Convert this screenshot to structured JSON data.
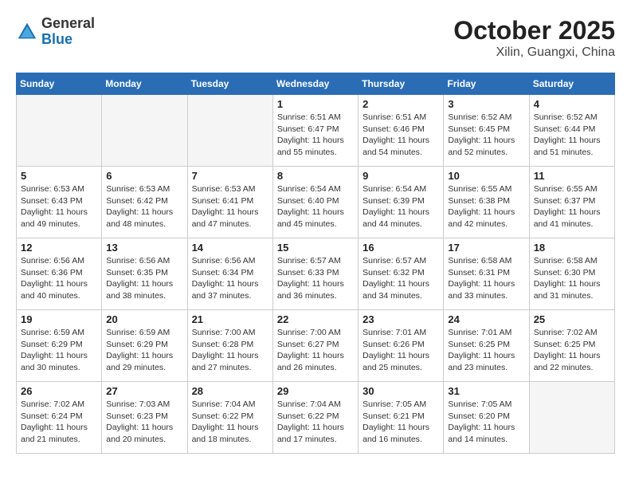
{
  "header": {
    "logo_general": "General",
    "logo_blue": "Blue",
    "title": "October 2025",
    "subtitle": "Xilin, Guangxi, China"
  },
  "days_of_week": [
    "Sunday",
    "Monday",
    "Tuesday",
    "Wednesday",
    "Thursday",
    "Friday",
    "Saturday"
  ],
  "weeks": [
    [
      {
        "day": "",
        "empty": true
      },
      {
        "day": "",
        "empty": true
      },
      {
        "day": "",
        "empty": true
      },
      {
        "day": "1",
        "sunrise": "6:51 AM",
        "sunset": "6:47 PM",
        "daylight": "11 hours and 55 minutes."
      },
      {
        "day": "2",
        "sunrise": "6:51 AM",
        "sunset": "6:46 PM",
        "daylight": "11 hours and 54 minutes."
      },
      {
        "day": "3",
        "sunrise": "6:52 AM",
        "sunset": "6:45 PM",
        "daylight": "11 hours and 52 minutes."
      },
      {
        "day": "4",
        "sunrise": "6:52 AM",
        "sunset": "6:44 PM",
        "daylight": "11 hours and 51 minutes."
      }
    ],
    [
      {
        "day": "5",
        "sunrise": "6:53 AM",
        "sunset": "6:43 PM",
        "daylight": "11 hours and 49 minutes."
      },
      {
        "day": "6",
        "sunrise": "6:53 AM",
        "sunset": "6:42 PM",
        "daylight": "11 hours and 48 minutes."
      },
      {
        "day": "7",
        "sunrise": "6:53 AM",
        "sunset": "6:41 PM",
        "daylight": "11 hours and 47 minutes."
      },
      {
        "day": "8",
        "sunrise": "6:54 AM",
        "sunset": "6:40 PM",
        "daylight": "11 hours and 45 minutes."
      },
      {
        "day": "9",
        "sunrise": "6:54 AM",
        "sunset": "6:39 PM",
        "daylight": "11 hours and 44 minutes."
      },
      {
        "day": "10",
        "sunrise": "6:55 AM",
        "sunset": "6:38 PM",
        "daylight": "11 hours and 42 minutes."
      },
      {
        "day": "11",
        "sunrise": "6:55 AM",
        "sunset": "6:37 PM",
        "daylight": "11 hours and 41 minutes."
      }
    ],
    [
      {
        "day": "12",
        "sunrise": "6:56 AM",
        "sunset": "6:36 PM",
        "daylight": "11 hours and 40 minutes."
      },
      {
        "day": "13",
        "sunrise": "6:56 AM",
        "sunset": "6:35 PM",
        "daylight": "11 hours and 38 minutes."
      },
      {
        "day": "14",
        "sunrise": "6:56 AM",
        "sunset": "6:34 PM",
        "daylight": "11 hours and 37 minutes."
      },
      {
        "day": "15",
        "sunrise": "6:57 AM",
        "sunset": "6:33 PM",
        "daylight": "11 hours and 36 minutes."
      },
      {
        "day": "16",
        "sunrise": "6:57 AM",
        "sunset": "6:32 PM",
        "daylight": "11 hours and 34 minutes."
      },
      {
        "day": "17",
        "sunrise": "6:58 AM",
        "sunset": "6:31 PM",
        "daylight": "11 hours and 33 minutes."
      },
      {
        "day": "18",
        "sunrise": "6:58 AM",
        "sunset": "6:30 PM",
        "daylight": "11 hours and 31 minutes."
      }
    ],
    [
      {
        "day": "19",
        "sunrise": "6:59 AM",
        "sunset": "6:29 PM",
        "daylight": "11 hours and 30 minutes."
      },
      {
        "day": "20",
        "sunrise": "6:59 AM",
        "sunset": "6:29 PM",
        "daylight": "11 hours and 29 minutes."
      },
      {
        "day": "21",
        "sunrise": "7:00 AM",
        "sunset": "6:28 PM",
        "daylight": "11 hours and 27 minutes."
      },
      {
        "day": "22",
        "sunrise": "7:00 AM",
        "sunset": "6:27 PM",
        "daylight": "11 hours and 26 minutes."
      },
      {
        "day": "23",
        "sunrise": "7:01 AM",
        "sunset": "6:26 PM",
        "daylight": "11 hours and 25 minutes."
      },
      {
        "day": "24",
        "sunrise": "7:01 AM",
        "sunset": "6:25 PM",
        "daylight": "11 hours and 23 minutes."
      },
      {
        "day": "25",
        "sunrise": "7:02 AM",
        "sunset": "6:25 PM",
        "daylight": "11 hours and 22 minutes."
      }
    ],
    [
      {
        "day": "26",
        "sunrise": "7:02 AM",
        "sunset": "6:24 PM",
        "daylight": "11 hours and 21 minutes."
      },
      {
        "day": "27",
        "sunrise": "7:03 AM",
        "sunset": "6:23 PM",
        "daylight": "11 hours and 20 minutes."
      },
      {
        "day": "28",
        "sunrise": "7:04 AM",
        "sunset": "6:22 PM",
        "daylight": "11 hours and 18 minutes."
      },
      {
        "day": "29",
        "sunrise": "7:04 AM",
        "sunset": "6:22 PM",
        "daylight": "11 hours and 17 minutes."
      },
      {
        "day": "30",
        "sunrise": "7:05 AM",
        "sunset": "6:21 PM",
        "daylight": "11 hours and 16 minutes."
      },
      {
        "day": "31",
        "sunrise": "7:05 AM",
        "sunset": "6:20 PM",
        "daylight": "11 hours and 14 minutes."
      },
      {
        "day": "",
        "empty": true
      }
    ]
  ],
  "labels": {
    "sunrise": "Sunrise:",
    "sunset": "Sunset:",
    "daylight": "Daylight:"
  }
}
